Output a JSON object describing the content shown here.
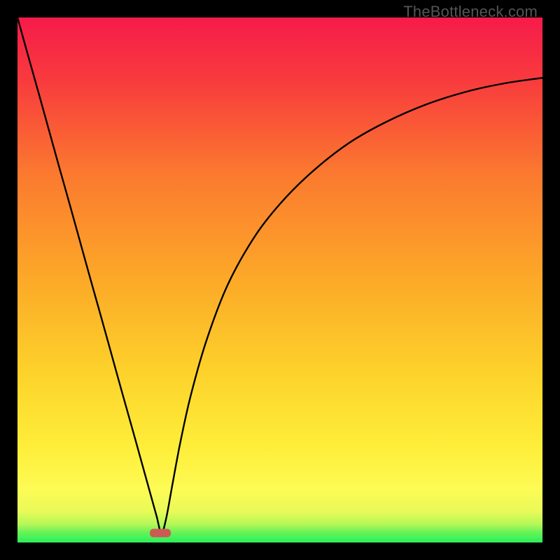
{
  "watermark": "TheBottleneck.com",
  "chart_data": {
    "type": "line",
    "title": "",
    "xlabel": "",
    "ylabel": "",
    "xlim": [
      0,
      100
    ],
    "ylim": [
      0,
      100
    ],
    "grid": false,
    "legend": false,
    "background_gradient": {
      "top_color": "#f61b4a",
      "mid_color": "#fdd32b",
      "bottom_region_color": "#29f05b",
      "bottom_region_start_pct": 97
    },
    "marker": {
      "shape": "rounded-rect",
      "x_pct": 27.2,
      "y_pct": 98.2,
      "color": "#cc5a54"
    },
    "series": [
      {
        "name": "curve",
        "color": "#000000",
        "x": [
          0,
          2,
          4,
          6,
          8,
          10,
          12,
          14,
          16,
          18,
          20,
          22,
          24,
          25.5,
          26.5,
          27.4,
          28.3,
          29.5,
          31,
          33,
          36,
          40,
          45,
          50,
          56,
          63,
          70,
          78,
          86,
          93,
          100
        ],
        "y": [
          100,
          92.8,
          85.7,
          78.5,
          71.3,
          64.2,
          57.0,
          49.8,
          42.7,
          35.5,
          28.3,
          21.2,
          14.0,
          8.6,
          5.0,
          1.8,
          4.5,
          11.0,
          19.0,
          28.0,
          38.5,
          49.0,
          58.0,
          64.5,
          70.5,
          76.0,
          80.0,
          83.5,
          86.0,
          87.5,
          88.5
        ]
      }
    ]
  }
}
